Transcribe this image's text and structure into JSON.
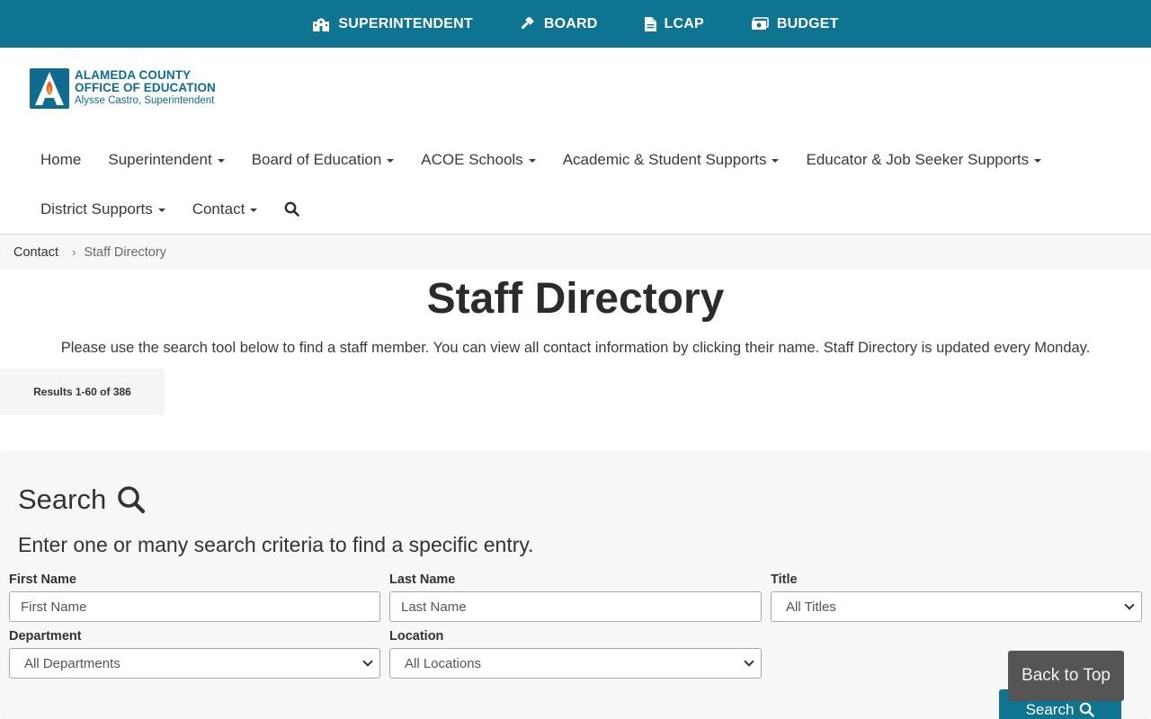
{
  "topbar": {
    "links": [
      {
        "label": "SUPERINTENDENT",
        "icon": "school-icon"
      },
      {
        "label": "BOARD",
        "icon": "gavel-icon"
      },
      {
        "label": "LCAP",
        "icon": "document-icon"
      },
      {
        "label": "BUDGET",
        "icon": "money-icon"
      }
    ]
  },
  "logo": {
    "line1": "ALAMEDA COUNTY",
    "line2": "OFFICE OF EDUCATION",
    "line3": "Alysse Castro, Superintendent"
  },
  "nav": {
    "items": [
      {
        "label": "Home"
      },
      {
        "label": "Superintendent"
      },
      {
        "label": "Board of Education"
      },
      {
        "label": "ACOE Schools"
      },
      {
        "label": "Academic & Student Supports"
      },
      {
        "label": "Educator & Job Seeker Supports"
      },
      {
        "label": "District Supports"
      },
      {
        "label": "Contact"
      }
    ]
  },
  "breadcrumb": {
    "parent": "Contact",
    "current": "Staff Directory"
  },
  "page": {
    "title": "Staff Directory",
    "intro": "Please use the search tool below to find a staff member. You can view all contact information by clicking their name. Staff Directory is updated every Monday.",
    "results": "Results 1-60 of 386"
  },
  "search": {
    "heading": "Search",
    "subheading": "Enter one or many search criteria to find a specific entry.",
    "first_name": {
      "label": "First Name",
      "placeholder": "First Name"
    },
    "last_name": {
      "label": "Last Name",
      "placeholder": "Last Name"
    },
    "title": {
      "label": "Title",
      "value": "All Titles"
    },
    "department": {
      "label": "Department",
      "value": "All Departments"
    },
    "location": {
      "label": "Location",
      "value": "All Locations"
    },
    "button": "Search"
  },
  "back_to_top": "Back to Top",
  "colors": {
    "brand": "#0f7490",
    "back_to_top": "#555555"
  }
}
